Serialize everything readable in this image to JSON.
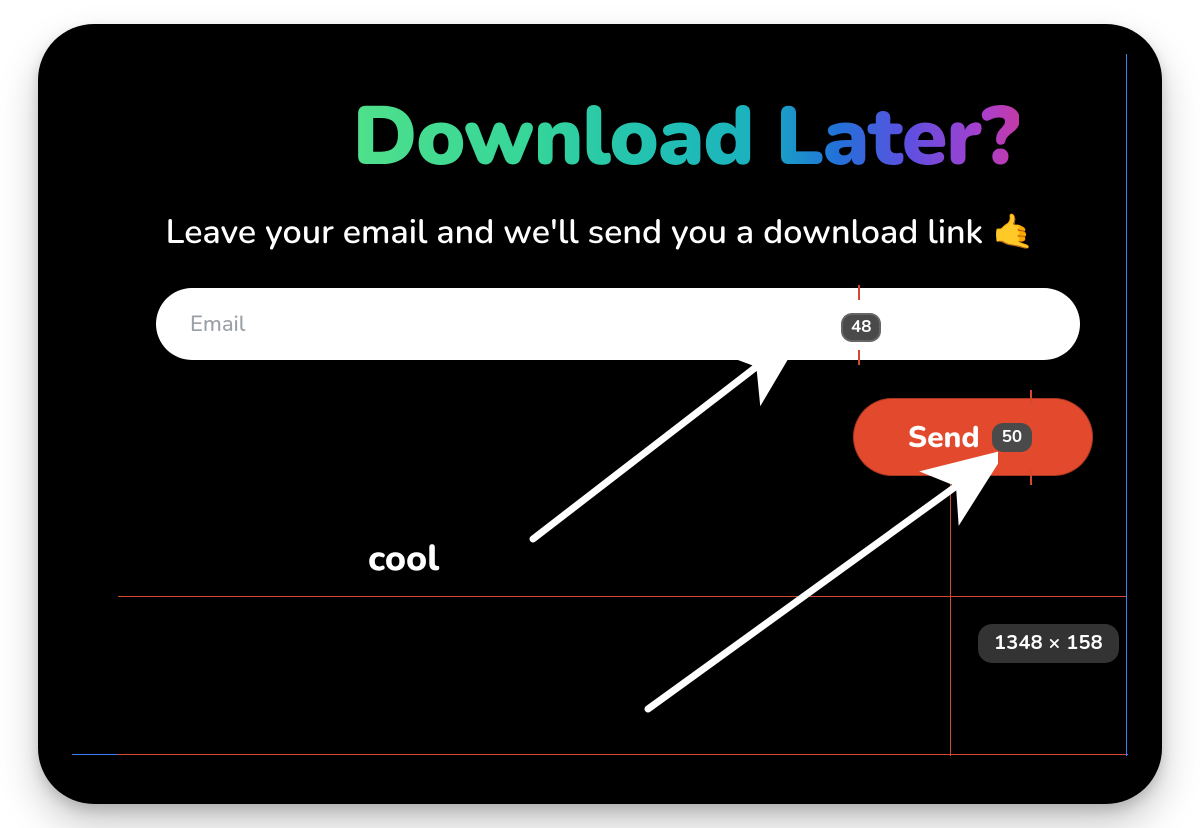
{
  "heading": {
    "word1": "Download",
    "word2": "Later?"
  },
  "subtitle_text": "Leave your email and we'll send you a download link 🤙",
  "form": {
    "email_placeholder": "Email",
    "send_label": "Send"
  },
  "annotation": {
    "text": "cool"
  },
  "inspector": {
    "input_height": "48",
    "button_height": "50",
    "selection_size": "1348 × 158"
  }
}
